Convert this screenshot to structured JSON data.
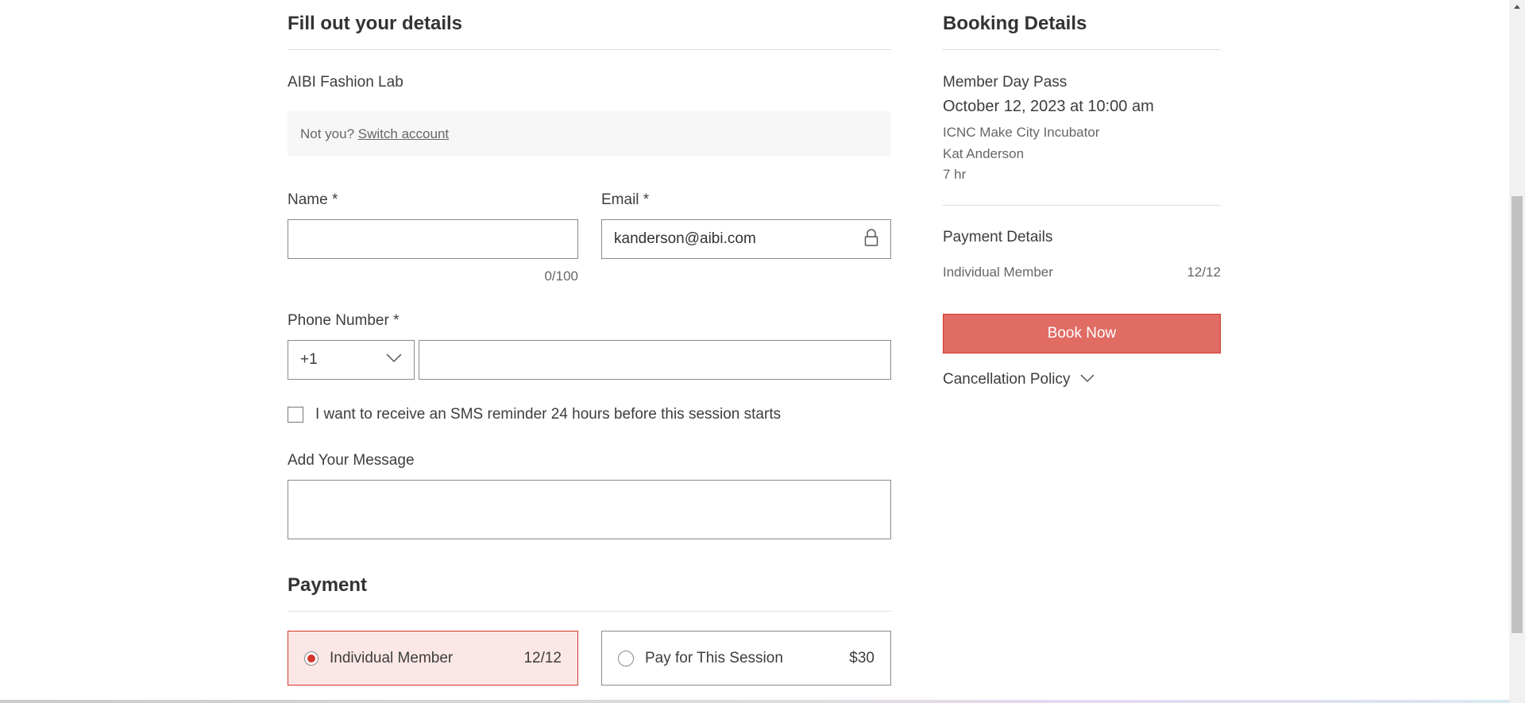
{
  "form": {
    "title": "Fill out your details",
    "account_name": "AIBI Fashion Lab",
    "not_you": "Not you?",
    "switch_account": "Switch account",
    "name_label": "Name *",
    "name_value": "",
    "name_counter": "0/100",
    "email_label": "Email *",
    "email_value": "kanderson@aibi.com",
    "phone_label": "Phone Number *",
    "country_code": "+1",
    "phone_value": "",
    "sms_label": "I want to receive an SMS reminder 24 hours before this session starts",
    "sms_checked": false,
    "message_label": "Add Your Message",
    "message_value": ""
  },
  "payment": {
    "title": "Payment",
    "options": [
      {
        "label": "Individual Member",
        "value": "12/12",
        "selected": true
      },
      {
        "label": "Pay for This Session",
        "value": "$30",
        "selected": false
      }
    ]
  },
  "booking": {
    "title": "Booking Details",
    "service": "Member Day Pass",
    "datetime": "October 12, 2023 at 10:00 am",
    "location": "ICNC Make City Incubator",
    "staff": "Kat Anderson",
    "duration": "7 hr",
    "payment_title": "Payment Details",
    "payment_label": "Individual Member",
    "payment_value": "12/12",
    "book_button": "Book Now",
    "cancellation": "Cancellation Policy"
  },
  "colors": {
    "accent": "#e06c64",
    "accent_border": "#d4372c",
    "selected_bg": "#fbe8e6"
  }
}
